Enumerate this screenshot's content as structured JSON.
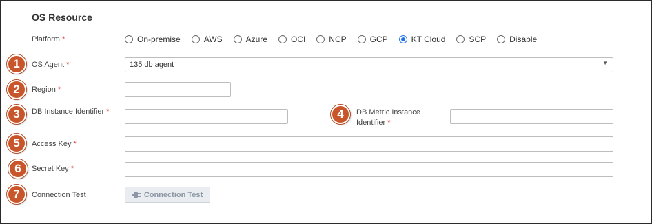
{
  "section_title": "OS Resource",
  "required_mark": "*",
  "platform": {
    "label": "Platform",
    "options": [
      "On-premise",
      "AWS",
      "Azure",
      "OCI",
      "NCP",
      "GCP",
      "KT Cloud",
      "SCP",
      "Disable"
    ],
    "selected": "KT Cloud"
  },
  "os_agent": {
    "label": "OS Agent",
    "value": "135 db agent"
  },
  "region": {
    "label": "Region",
    "value": ""
  },
  "db_instance_identifier": {
    "label": "DB Instance Identifier",
    "value": ""
  },
  "db_metric_instance_identifier": {
    "label_line1": "DB Metric Instance",
    "label_line2": "Identifier",
    "value": ""
  },
  "access_key": {
    "label": "Access Key",
    "value": ""
  },
  "secret_key": {
    "label": "Secret Key",
    "value": ""
  },
  "connection_test": {
    "label": "Connection Test",
    "button_label": "Connection Test"
  },
  "markers": [
    "1",
    "2",
    "3",
    "4",
    "5",
    "6",
    "7"
  ],
  "colors": {
    "marker": "#c9562a",
    "required": "#e53935",
    "radio_selected": "#1e73e8"
  }
}
